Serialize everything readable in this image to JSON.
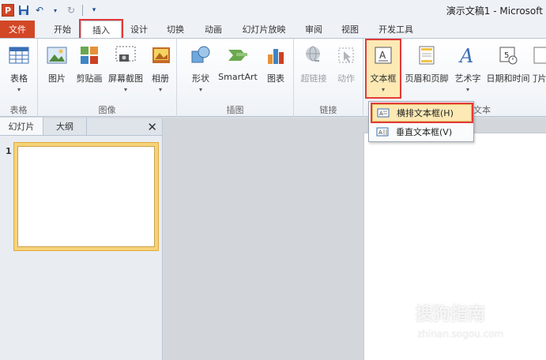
{
  "window": {
    "title": "演示文稿1 - Microsoft"
  },
  "qat": {
    "app_letter": "P"
  },
  "tabs": [
    {
      "label": "文件"
    },
    {
      "label": "开始"
    },
    {
      "label": "插入"
    },
    {
      "label": "设计"
    },
    {
      "label": "切换"
    },
    {
      "label": "动画"
    },
    {
      "label": "幻灯片放映"
    },
    {
      "label": "审阅"
    },
    {
      "label": "视图"
    },
    {
      "label": "开发工具"
    }
  ],
  "ribbon": {
    "buttons": [
      {
        "label": "表格"
      },
      {
        "label": "图片"
      },
      {
        "label": "剪贴画"
      },
      {
        "label": "屏幕截图"
      },
      {
        "label": "相册"
      },
      {
        "label": "形状"
      },
      {
        "label": "SmartArt"
      },
      {
        "label": "图表"
      },
      {
        "label": "超链接"
      },
      {
        "label": "动作"
      },
      {
        "label": "文本框"
      },
      {
        "label": "页眉和页脚"
      },
      {
        "label": "艺术字"
      },
      {
        "label": "日期和时间"
      },
      {
        "label": "幻灯片编号"
      }
    ],
    "groups": [
      {
        "label": "表格"
      },
      {
        "label": "图像"
      },
      {
        "label": "插图"
      },
      {
        "label": "链接"
      },
      {
        "label": "文本"
      }
    ]
  },
  "leftpane": {
    "tabs": [
      {
        "label": "幻灯片"
      },
      {
        "label": "大纲"
      }
    ],
    "close": "✕",
    "slide_number": "1"
  },
  "dropdown": {
    "items": [
      {
        "label": "横排文本框(H)"
      },
      {
        "label": "垂直文本框(V)"
      }
    ]
  },
  "watermark": {
    "text": "搜狗指南",
    "url": "zhinan.sogou.com"
  }
}
